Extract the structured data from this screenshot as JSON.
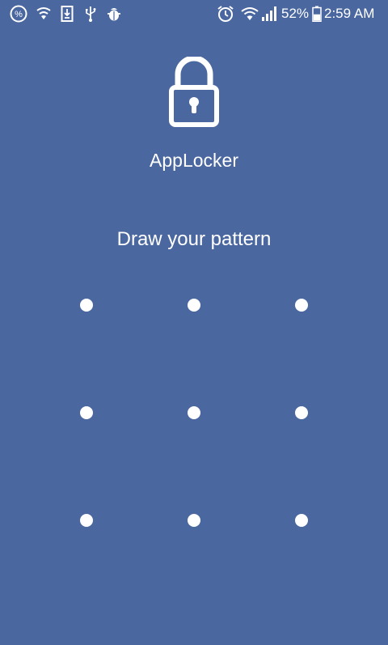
{
  "status_bar": {
    "icons_left": [
      "percent-badge-icon",
      "wifi-shield-icon",
      "download-phone-icon",
      "usb-icon",
      "debug-bug-icon"
    ],
    "icons_right": [
      "alarm-clock-icon",
      "wifi-signal-icon",
      "cell-signal-icon",
      "battery-icon"
    ],
    "battery_percent": "52%",
    "battery_level": 0.52,
    "time": "2:59 AM"
  },
  "app": {
    "icon": "lock-icon",
    "name": "AppLocker"
  },
  "pattern": {
    "prompt": "Draw your pattern",
    "rows": 3,
    "cols": 3
  },
  "colors": {
    "background": "#4a67a0",
    "foreground": "#ffffff"
  }
}
